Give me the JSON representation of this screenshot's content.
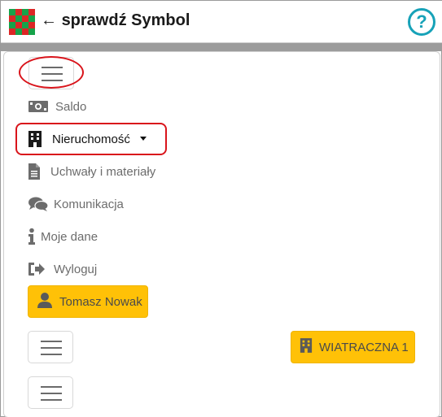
{
  "header": {
    "back_arrow": "←",
    "title": "sprawdź Symbol",
    "help_icon": "question-circle-icon",
    "help_symbol": "?"
  },
  "logo": {
    "cells": [
      "#16a34a",
      "#dc2626",
      "#16a34a",
      "#dc2626",
      "#dc2626",
      "#16a34a",
      "#dc2626",
      "#16a34a",
      "#16a34a",
      "#dc2626",
      "#16a34a",
      "#dc2626",
      "#dc2626",
      "#16a34a",
      "#dc2626",
      "#16a34a"
    ]
  },
  "nav": {
    "items": [
      {
        "label": "Saldo",
        "icon": "money-bill-icon"
      },
      {
        "label": "Nieruchomość",
        "icon": "building-icon"
      },
      {
        "label": "Uchwały i materiały",
        "icon": "file-icon"
      },
      {
        "label": "Komunikacja",
        "icon": "comments-icon"
      },
      {
        "label": "Moje dane",
        "icon": "info-icon"
      },
      {
        "label": "Wyloguj",
        "icon": "sign-out-icon"
      }
    ]
  },
  "user": {
    "name": "Tomasz Nowak",
    "icon": "user-icon"
  },
  "property": {
    "name": "WIATRACZNA 1",
    "icon": "building-icon"
  },
  "colors": {
    "accent_yellow": "#ffc107",
    "help_teal": "#17a2b8",
    "highlight_red": "#d9141b"
  }
}
